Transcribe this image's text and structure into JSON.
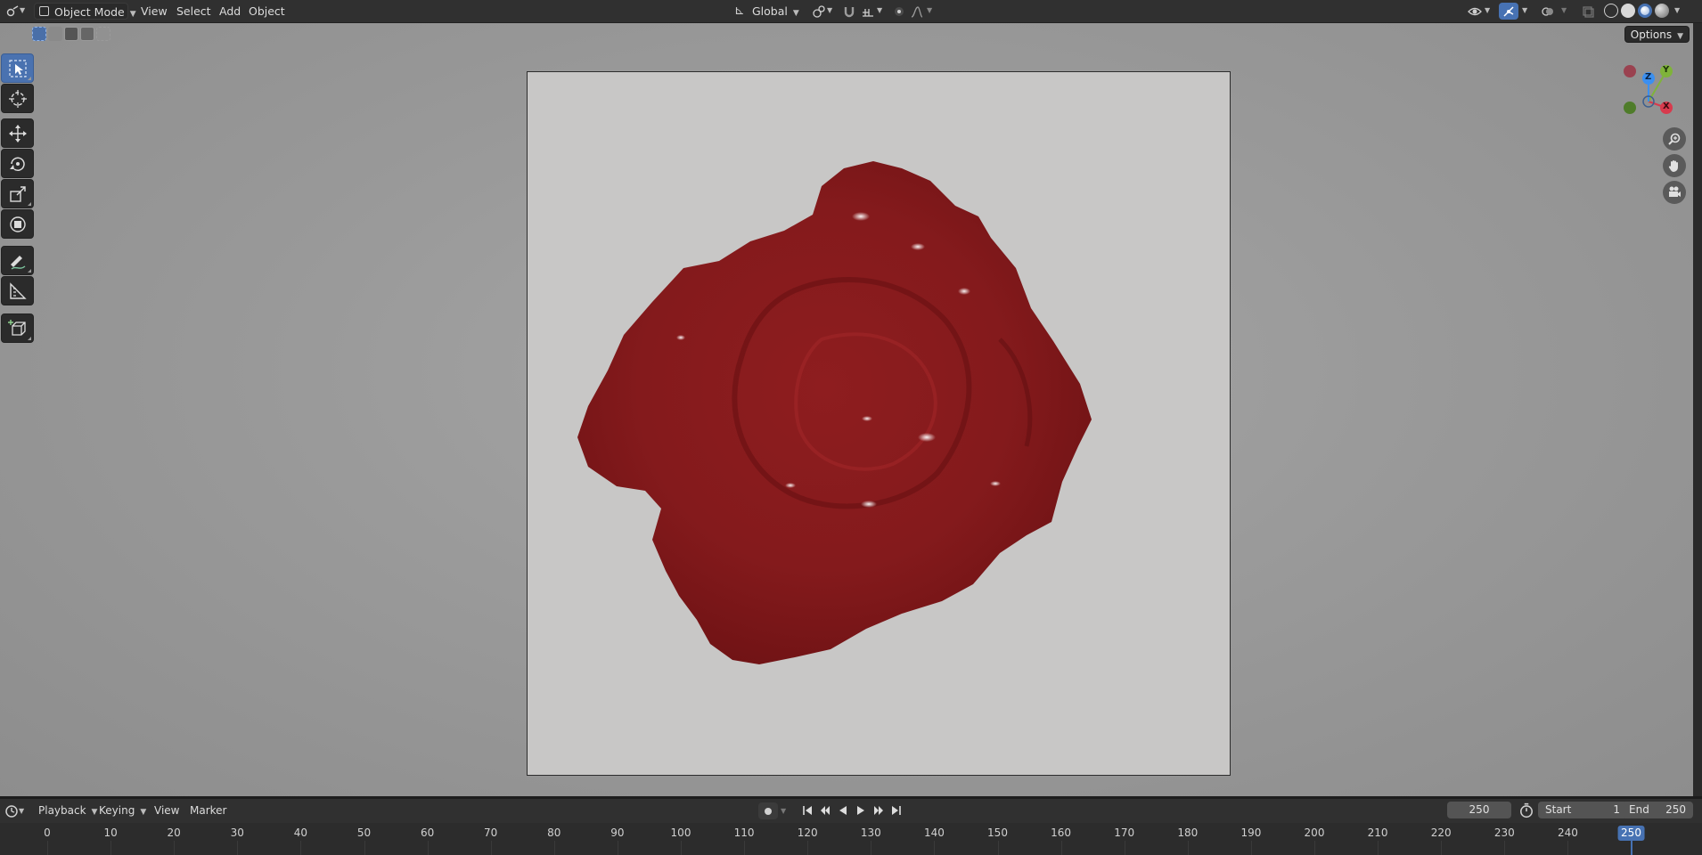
{
  "header": {
    "mode_label": "Object Mode",
    "menus": [
      "View",
      "Select",
      "Add",
      "Object"
    ],
    "orientation_label": "Global"
  },
  "viewport": {
    "options_label": "Options",
    "gizmo_axes": {
      "x": "X",
      "y": "Y",
      "z": "Z"
    },
    "axis_colors": {
      "x": "#d83a4d",
      "y": "#7fb33a",
      "z": "#3b8ff0"
    },
    "tools": [
      "select-box",
      "cursor",
      "move",
      "rotate",
      "scale",
      "transform",
      "annotate",
      "measure",
      "add-cube"
    ],
    "object_color": "#8c1c1f"
  },
  "timeline": {
    "menus": [
      "Playback",
      "Keying",
      "View",
      "Marker"
    ],
    "current_frame": "250",
    "start_label": "Start",
    "start_value": "1",
    "end_label": "End",
    "end_value": "250",
    "ruler_ticks": [
      "0",
      "10",
      "20",
      "30",
      "40",
      "50",
      "60",
      "70",
      "80",
      "90",
      "100",
      "110",
      "120",
      "130",
      "140",
      "150",
      "160",
      "170",
      "180",
      "190",
      "200",
      "210",
      "220",
      "230",
      "240"
    ],
    "playhead_label": "250"
  }
}
